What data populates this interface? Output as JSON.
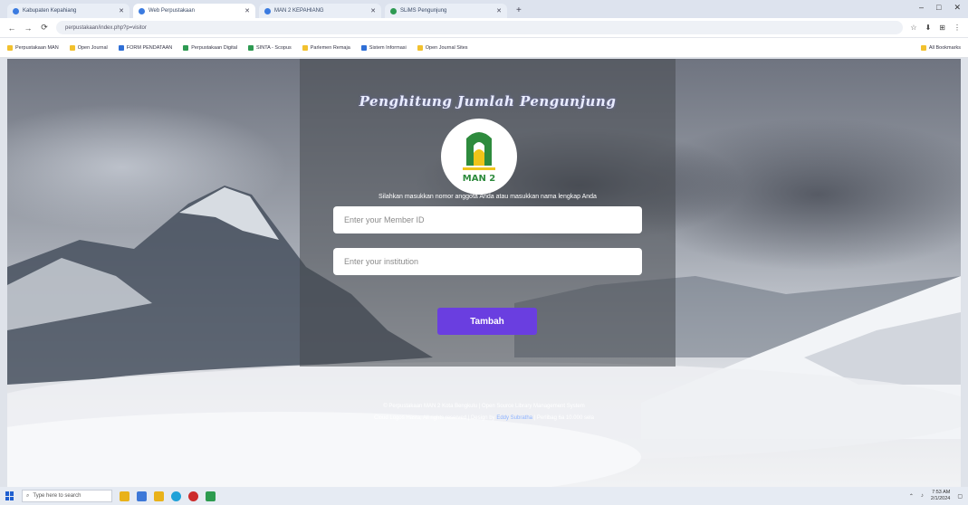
{
  "browser": {
    "tabs": [
      {
        "label": "Kabupaten Kepahiang"
      },
      {
        "label": "Web Perpustakaan"
      },
      {
        "label": "MAN 2 KEPAHIANG"
      },
      {
        "label": "SLiMS Pengunjung"
      }
    ],
    "new_tab": "+",
    "url": "perpustakaan/index.php?p=visitor",
    "window_controls": [
      "–",
      "□",
      "✕"
    ],
    "nav": {
      "back": "←",
      "forward": "→",
      "reload": "⟳",
      "home": "⌂"
    },
    "tools": [
      "☆",
      "⬇",
      "⊞",
      "⋮"
    ],
    "bookmarks": [
      {
        "label": "Perpustakaan MAN"
      },
      {
        "label": "Open Journal"
      },
      {
        "label": "FORM PENDATAAN"
      },
      {
        "label": "Perpustakaan Digital"
      },
      {
        "label": "SINTA - Scopus"
      },
      {
        "label": "Parlemen Remaja"
      },
      {
        "label": "Sistem Informasi"
      },
      {
        "label": "Open Journal Sites"
      }
    ],
    "all_bookmarks": "All Bookmarks"
  },
  "visitor": {
    "title": "Penghitung Jumlah Pengunjung",
    "logo_text": "MAN 2",
    "instruction": "Silahkan masukkan nomor anggota Anda atau masukkan nama lengkap Anda",
    "member_placeholder": "Enter your Member ID",
    "institution_placeholder": "Enter your institution",
    "submit_label": "Tambah"
  },
  "footer": {
    "line1": "© Perpustakaan MAN 2 Kota Bengkulu | Open Source Library Management System",
    "line2_pre": "Cloud Logos Hasta, All rights reserved | Design by",
    "line2_link": "Eddy Subratha",
    "line2_post": "| Perlibag 6a 10.000 sela"
  },
  "taskbar": {
    "search_placeholder": "Type here to search",
    "time": "7:53 AM",
    "date": "2/1/2024"
  }
}
